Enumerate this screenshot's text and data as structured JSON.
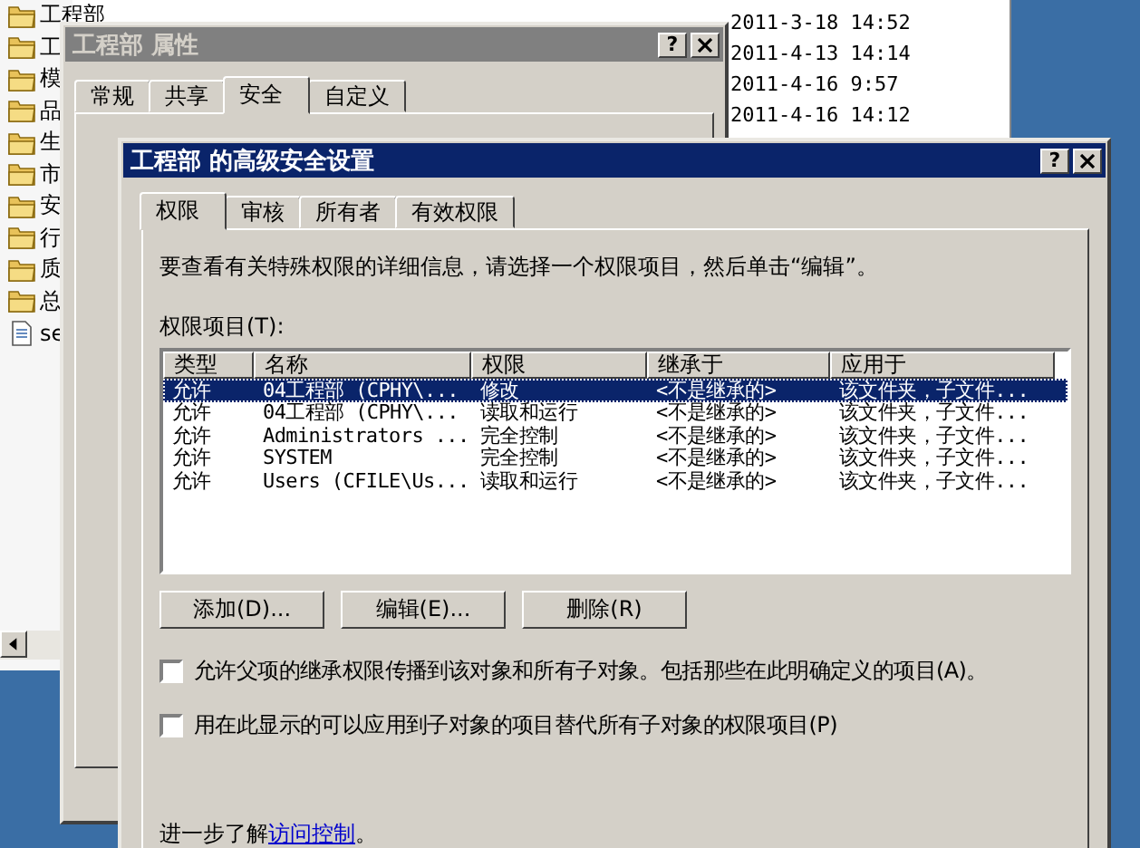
{
  "explorer": {
    "tree": [
      {
        "label": "工程部",
        "kind": "folder"
      },
      {
        "label": "工",
        "kind": "folder"
      },
      {
        "label": "模",
        "kind": "folder"
      },
      {
        "label": "品",
        "kind": "folder"
      },
      {
        "label": "生",
        "kind": "folder"
      },
      {
        "label": "市",
        "kind": "folder"
      },
      {
        "label": "安",
        "kind": "folder"
      },
      {
        "label": "行",
        "kind": "folder"
      },
      {
        "label": "质",
        "kind": "folder"
      },
      {
        "label": "总",
        "kind": "folder"
      },
      {
        "label": "se",
        "kind": "file"
      }
    ],
    "dates": [
      "2011-3-18 14:52",
      "2011-4-13 14:14",
      "2011-4-16 9:57",
      "2011-4-16 14:12"
    ]
  },
  "properties": {
    "title": "工程部 属性",
    "help": "?",
    "tabs": [
      {
        "label": "常规",
        "selected": false
      },
      {
        "label": "共享",
        "selected": false
      },
      {
        "label": "安全",
        "selected": true
      },
      {
        "label": "自定义",
        "selected": false
      }
    ]
  },
  "advanced": {
    "title": "工程部 的高级安全设置",
    "help": "?",
    "tabs": [
      {
        "label": "权限",
        "selected": true
      },
      {
        "label": "审核",
        "selected": false
      },
      {
        "label": "所有者",
        "selected": false
      },
      {
        "label": "有效权限",
        "selected": false
      }
    ],
    "description": "要查看有关特殊权限的详细信息，请选择一个权限项目，然后单击“编辑”。",
    "list_label": "权限项目(T):",
    "columns": [
      "类型",
      "名称",
      "权限",
      "继承于",
      "应用于"
    ],
    "rows": [
      {
        "cells": [
          "允许",
          "04工程部 (CPHY\\...",
          "修改",
          "<不是继承的>",
          "该文件夹，子文件..."
        ],
        "selected": true
      },
      {
        "cells": [
          "允许",
          "04工程部 (CPHY\\...",
          "读取和运行",
          "<不是继承的>",
          "该文件夹，子文件..."
        ],
        "selected": false
      },
      {
        "cells": [
          "允许",
          "Administrators ...",
          "完全控制",
          "<不是继承的>",
          "该文件夹，子文件..."
        ],
        "selected": false
      },
      {
        "cells": [
          "允许",
          "SYSTEM",
          "完全控制",
          "<不是继承的>",
          "该文件夹，子文件..."
        ],
        "selected": false
      },
      {
        "cells": [
          "允许",
          "Users (CFILE\\Us...",
          "读取和运行",
          "<不是继承的>",
          "该文件夹，子文件..."
        ],
        "selected": false
      }
    ],
    "buttons": [
      "添加(D)...",
      "编辑(E)...",
      "删除(R)"
    ],
    "checkboxes": [
      {
        "label": "允许父项的继承权限传播到该对象和所有子对象。包括那些在此明确定义的项目(A)。",
        "checked": false
      },
      {
        "label": "用在此显示的可以应用到子对象的项目替代所有子对象的权限项目(P)",
        "checked": false
      }
    ],
    "footer": {
      "text": "进一步了解",
      "link": "访问控制",
      "end": "。"
    }
  }
}
